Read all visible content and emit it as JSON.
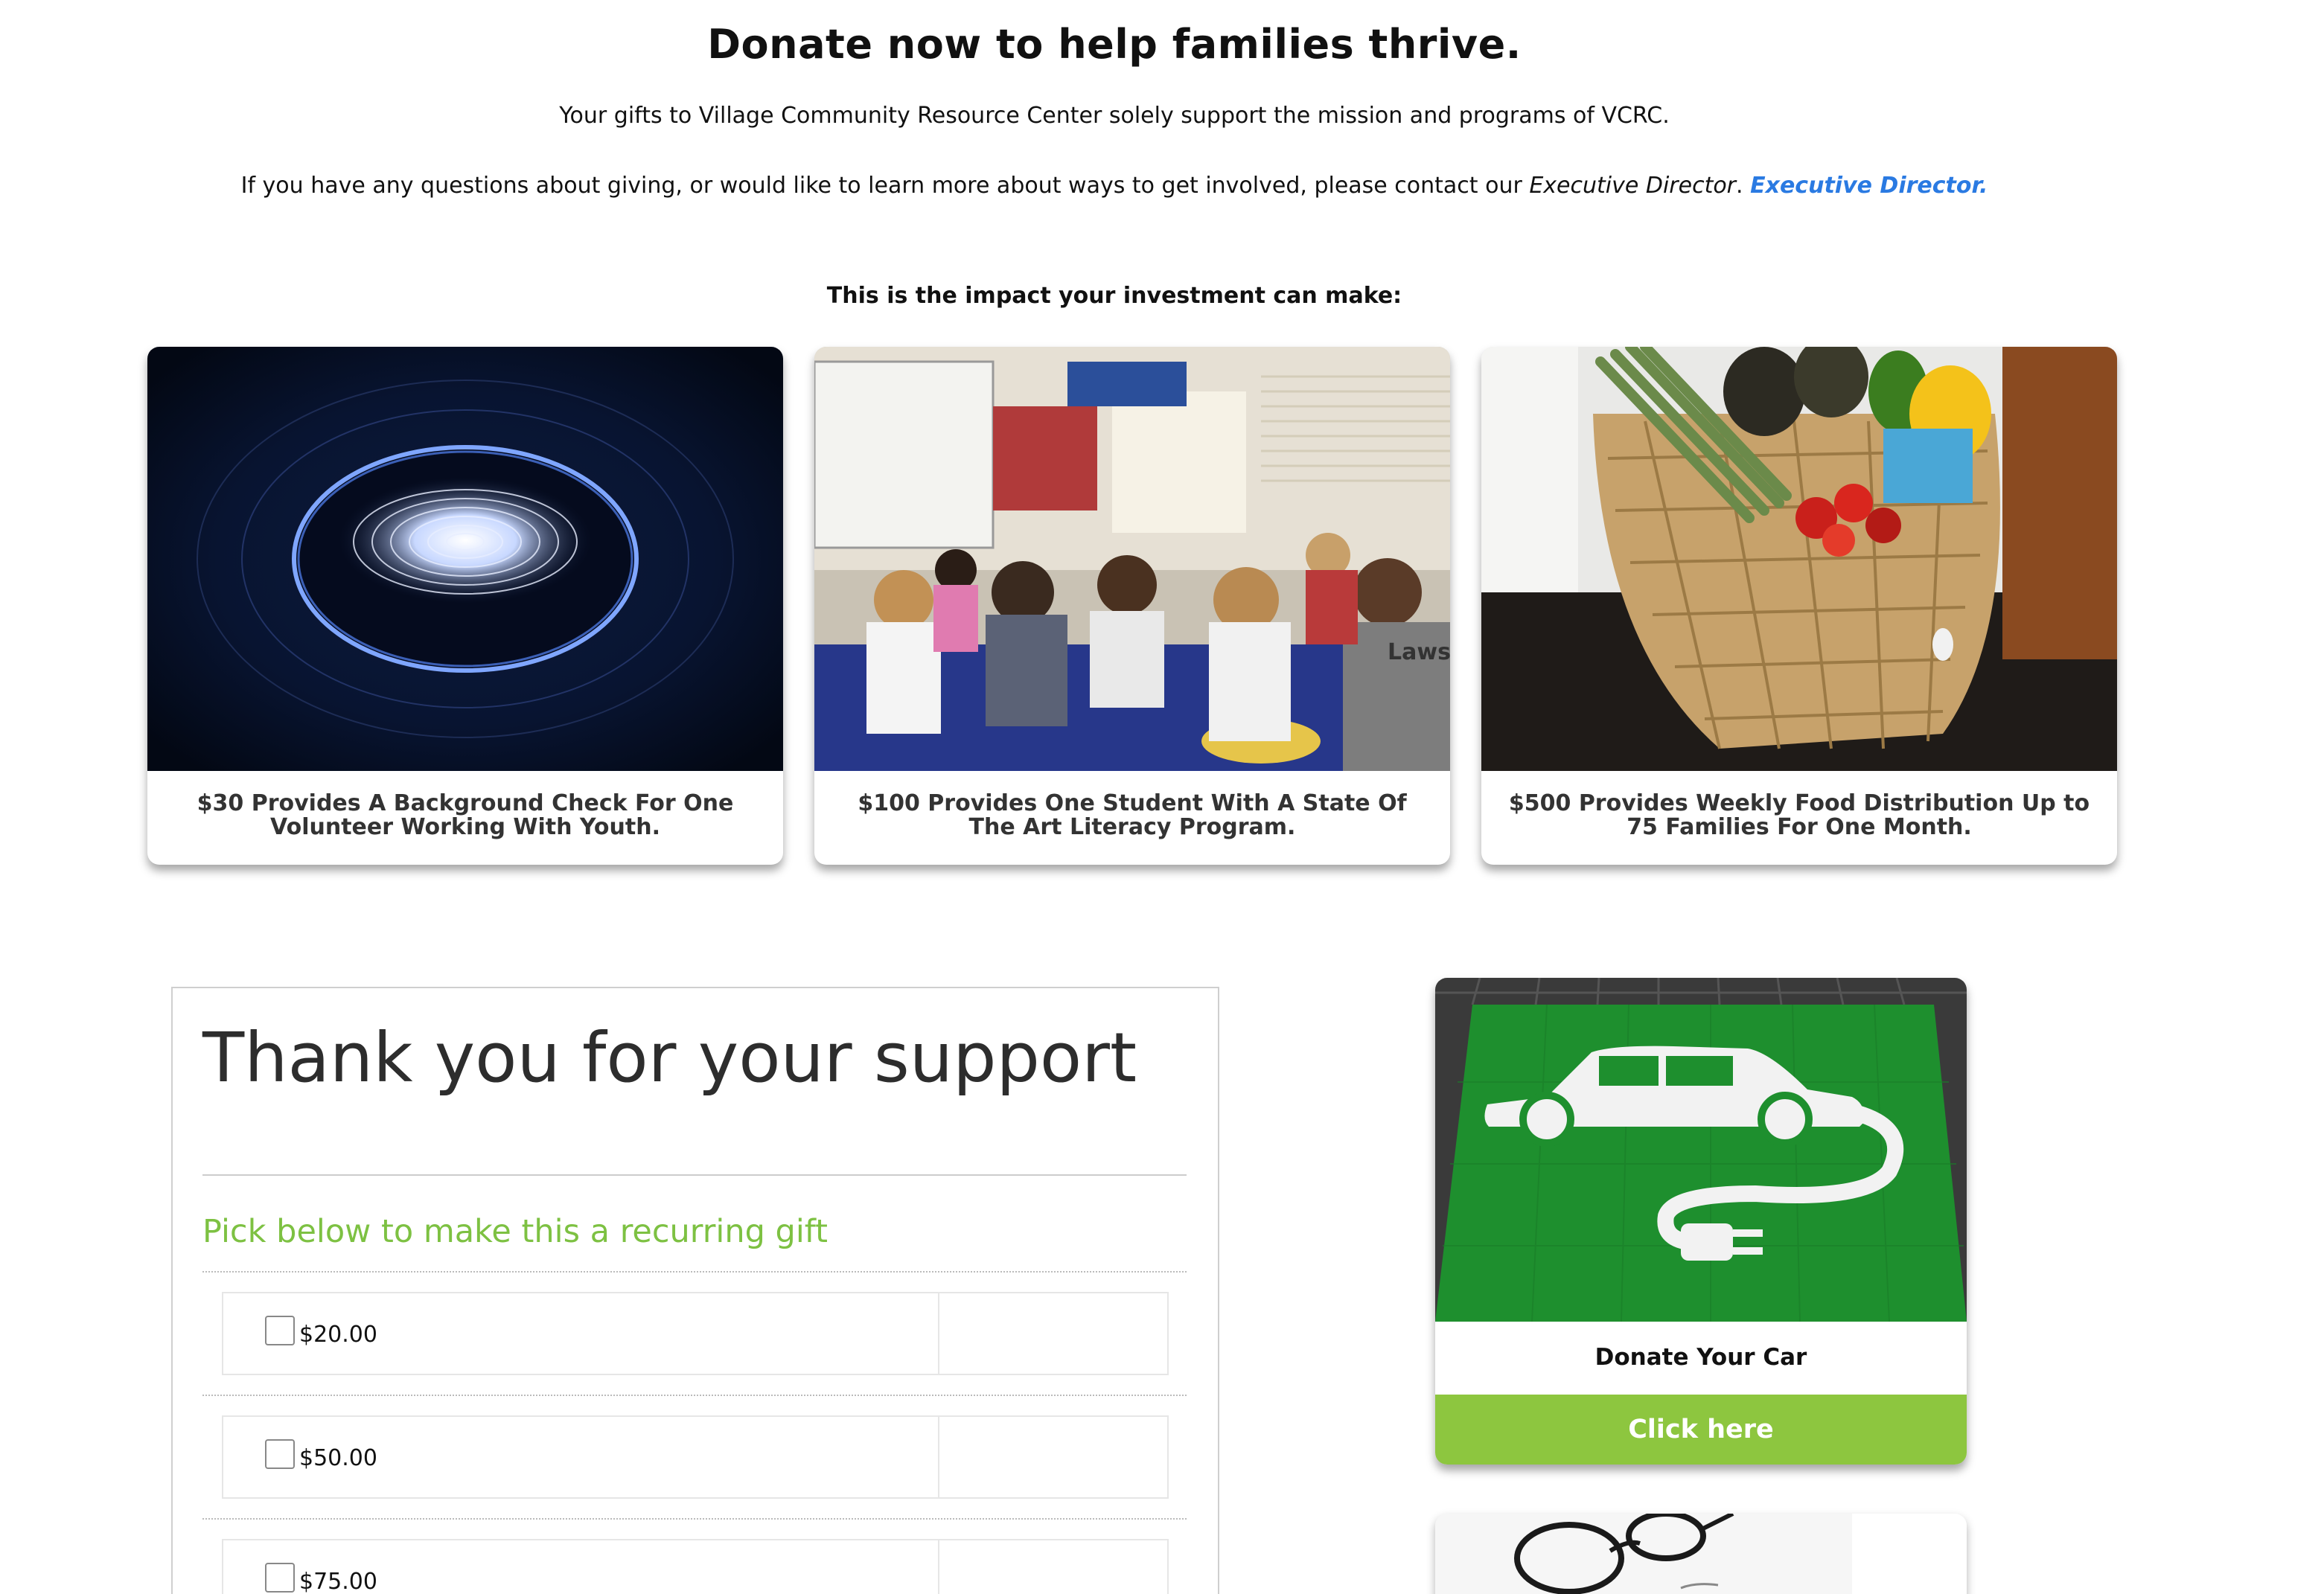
{
  "hero": {
    "title": "Donate now to help families thrive.",
    "line1": "Your gifts to Village Community Resource Center solely support the mission and programs of VCRC.",
    "line2_prefix": "If you have any questions about giving, or would like to learn more about ways to get involved, please contact our ",
    "line2_italic": "Executive Director",
    "line2_sep": ". ",
    "line2_link": "Executive Director."
  },
  "impact": {
    "heading": "This is the impact your investment can make:",
    "cards": [
      {
        "caption": "$30 Provides A Background Check For One Volunteer Working With Youth.",
        "image": "fingerprint-image"
      },
      {
        "caption": "$100 Provides One Student With A State Of The Art Literacy Program.",
        "image": "classroom-image"
      },
      {
        "caption": "$500 Provides Weekly Food Distribution Up to 75 Families For One Month.",
        "image": "produce-basket-image"
      }
    ]
  },
  "form": {
    "title": "Thank you for your support",
    "recurring_title": "Pick below to make this a recurring gift",
    "amounts": [
      {
        "label": "$20.00",
        "checked": false
      },
      {
        "label": "$50.00",
        "checked": false
      },
      {
        "label": "$75.00",
        "checked": false
      }
    ]
  },
  "car": {
    "label": "Donate Your Car",
    "button": "Click here",
    "image": "electric-car-parking-image"
  },
  "colors": {
    "link": "#2a7ae2",
    "accent_green": "#8dc63f",
    "recurring_green": "#7dc142"
  }
}
